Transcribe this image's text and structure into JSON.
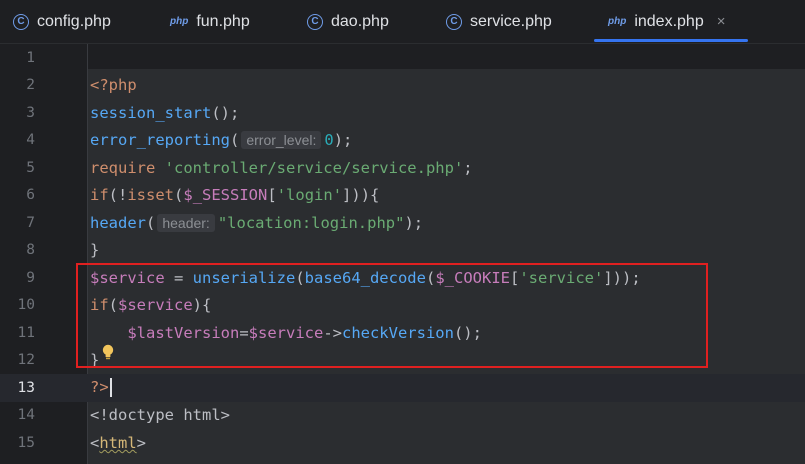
{
  "tabs": [
    {
      "icon": "class-icon",
      "label": "config.php",
      "active": false
    },
    {
      "icon": "php-icon",
      "icon_text": "php",
      "label": "fun.php",
      "active": false
    },
    {
      "icon": "class-icon",
      "label": "dao.php",
      "active": false
    },
    {
      "icon": "class-icon",
      "label": "service.php",
      "active": false
    },
    {
      "icon": "php-icon",
      "icon_text": "php",
      "label": "index.php",
      "active": true,
      "close": "×"
    }
  ],
  "class_icon_glyph": "C",
  "current_line": 13,
  "line_numbers": [
    "1",
    "2",
    "3",
    "4",
    "5",
    "6",
    "7",
    "8",
    "9",
    "10",
    "11",
    "12",
    "13",
    "14",
    "15"
  ],
  "code": {
    "l2": {
      "open": "<?php"
    },
    "l3": {
      "fn": "session_start",
      "rest": "();"
    },
    "l4": {
      "fn": "error_reporting",
      "paren": "(",
      "hint": "error_level:",
      "num": "0",
      "rest": ");"
    },
    "l5": {
      "kw": "require",
      "sp": " ",
      "str": "'controller/service/service.php'",
      "rest": ";"
    },
    "l6": {
      "kw": "if",
      "p1": "(!",
      "kw2": "isset",
      "p2": "(",
      "var": "$_SESSION",
      "p3": "[",
      "str": "'login'",
      "p4": "])){"
    },
    "l7": {
      "fn": "header",
      "paren": "(",
      "hint": "header:",
      "str": "\"location:login.php\"",
      "rest": ");"
    },
    "l8": {
      "text": "}"
    },
    "l9": {
      "var": "$service",
      "eq": " = ",
      "fn1": "unserialize",
      "p1": "(",
      "fn2": "base64_decode",
      "p2": "(",
      "var2": "$_COOKIE",
      "p3": "[",
      "str": "'service'",
      "p4": "]));"
    },
    "l10": {
      "kw": "if",
      "p1": "(",
      "var": "$service",
      "p2": "){"
    },
    "l11": {
      "indent": "    ",
      "var": "$lastVersion",
      "eq": "=",
      "var2": "$service",
      "arrow": "->",
      "fn": "checkVersion",
      "rest": "();"
    },
    "l12": {
      "text": "}"
    },
    "l13": {
      "close": "?>"
    },
    "l14": {
      "text": "<!doctype html>"
    },
    "l15": {
      "lt": "<",
      "tag": "html",
      "gt": ">"
    }
  },
  "colors": {
    "background": "#1e1f22",
    "keyword": "#cf8e6d",
    "function": "#56a8f5",
    "string": "#6aab73",
    "variable": "#c77dbb",
    "number": "#2aacb8",
    "highlight_box": "#e02020",
    "active_tab": "#3574f0"
  }
}
